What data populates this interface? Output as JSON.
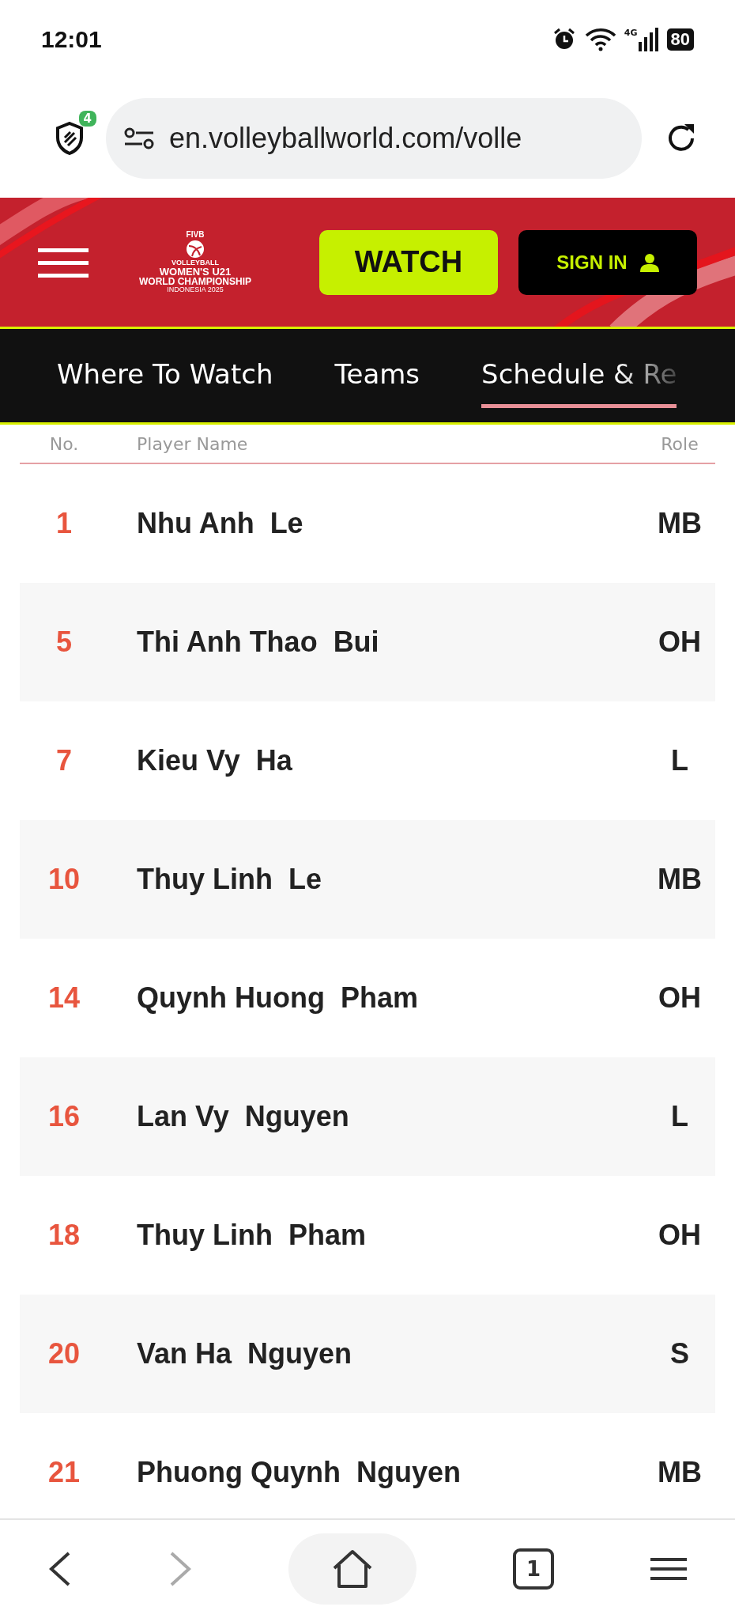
{
  "status_bar": {
    "time": "12:01",
    "network": "4G",
    "battery": "80"
  },
  "browser": {
    "shield_badge": "4",
    "url": "en.volleyballworld.com/volle"
  },
  "header": {
    "logo_lines": [
      "FIVB",
      "VOLLEYBALL",
      "WOMEN'S U21",
      "WORLD CHAMPIONSHIP",
      "INDONESIA 2025"
    ],
    "watch_button": "WATCH",
    "sign_in_button": "SIGN IN"
  },
  "nav": [
    {
      "label": "Where To Watch",
      "selected": false
    },
    {
      "label": "Teams",
      "selected": false
    },
    {
      "label": "Schedule & Re",
      "selected": true
    }
  ],
  "table": {
    "columns": [
      "No.",
      "Player Name",
      "Role"
    ],
    "rows": [
      {
        "no": "1",
        "name": "Nhu Anh  Le",
        "role": "MB"
      },
      {
        "no": "5",
        "name": "Thi Anh Thao  Bui",
        "role": "OH"
      },
      {
        "no": "7",
        "name": "Kieu Vy  Ha",
        "role": "L"
      },
      {
        "no": "10",
        "name": "Thuy Linh  Le",
        "role": "MB"
      },
      {
        "no": "14",
        "name": "Quynh Huong  Pham",
        "role": "OH"
      },
      {
        "no": "16",
        "name": "Lan Vy  Nguyen",
        "role": "L"
      },
      {
        "no": "18",
        "name": "Thuy Linh  Pham",
        "role": "OH"
      },
      {
        "no": "20",
        "name": "Van Ha  Nguyen",
        "role": "S"
      },
      {
        "no": "21",
        "name": "Phuong Quynh  Nguyen",
        "role": "MB"
      }
    ]
  },
  "bottom_bar": {
    "tab_count": "1"
  }
}
